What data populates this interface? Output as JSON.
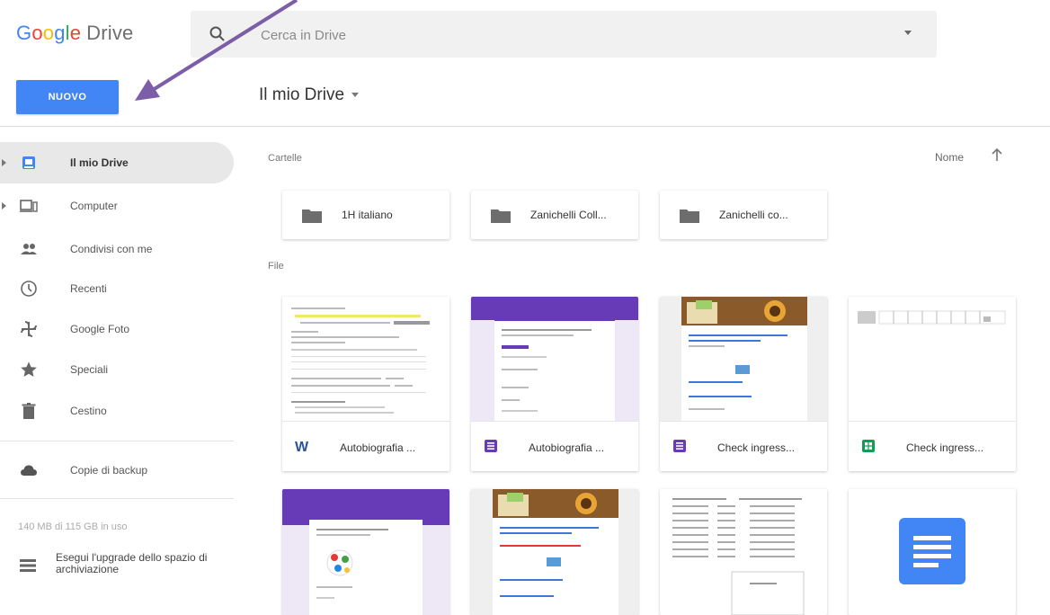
{
  "header": {
    "logo_google": [
      "G",
      "o",
      "o",
      "g",
      "l",
      "e"
    ],
    "logo_drive": "Drive",
    "search_placeholder": "Cerca in Drive"
  },
  "toolbar": {
    "new_label": "NUOVO",
    "location_title": "Il mio Drive"
  },
  "sidebar": {
    "items": [
      {
        "label": "Il mio Drive",
        "icon": "my-drive-icon",
        "active": true
      },
      {
        "label": "Computer",
        "icon": "computer-icon"
      },
      {
        "label": "Condivisi con me",
        "icon": "shared-icon"
      },
      {
        "label": "Recenti",
        "icon": "clock-icon"
      },
      {
        "label": "Google Foto",
        "icon": "photos-icon"
      },
      {
        "label": "Speciali",
        "icon": "star-icon"
      },
      {
        "label": "Cestino",
        "icon": "trash-icon"
      },
      {
        "label": "Copie di backup",
        "icon": "cloud-icon"
      }
    ],
    "storage_text": "140 MB di 115 GB in uso",
    "upgrade_label": "Esegui l'upgrade dello spazio di archiviazione"
  },
  "main": {
    "folders_label": "Cartelle",
    "sort_label": "Nome",
    "folders": [
      {
        "name": "1H italiano"
      },
      {
        "name": "Zanichelli Coll..."
      },
      {
        "name": "Zanichelli co..."
      }
    ],
    "files_label": "File",
    "files": [
      {
        "name": "Autobiografia ...",
        "type": "word",
        "type_color": "#2a5699"
      },
      {
        "name": "Autobiografia ...",
        "type": "forms",
        "type_color": "#673ab7"
      },
      {
        "name": "Check ingress...",
        "type": "forms",
        "type_color": "#673ab7"
      },
      {
        "name": "Check ingress...",
        "type": "sheets",
        "type_color": "#0f9d58"
      }
    ]
  },
  "colors": {
    "accent": "#4285f4",
    "annotation_arrow": "#7b5ea7",
    "forms_purple": "#673ab7"
  }
}
